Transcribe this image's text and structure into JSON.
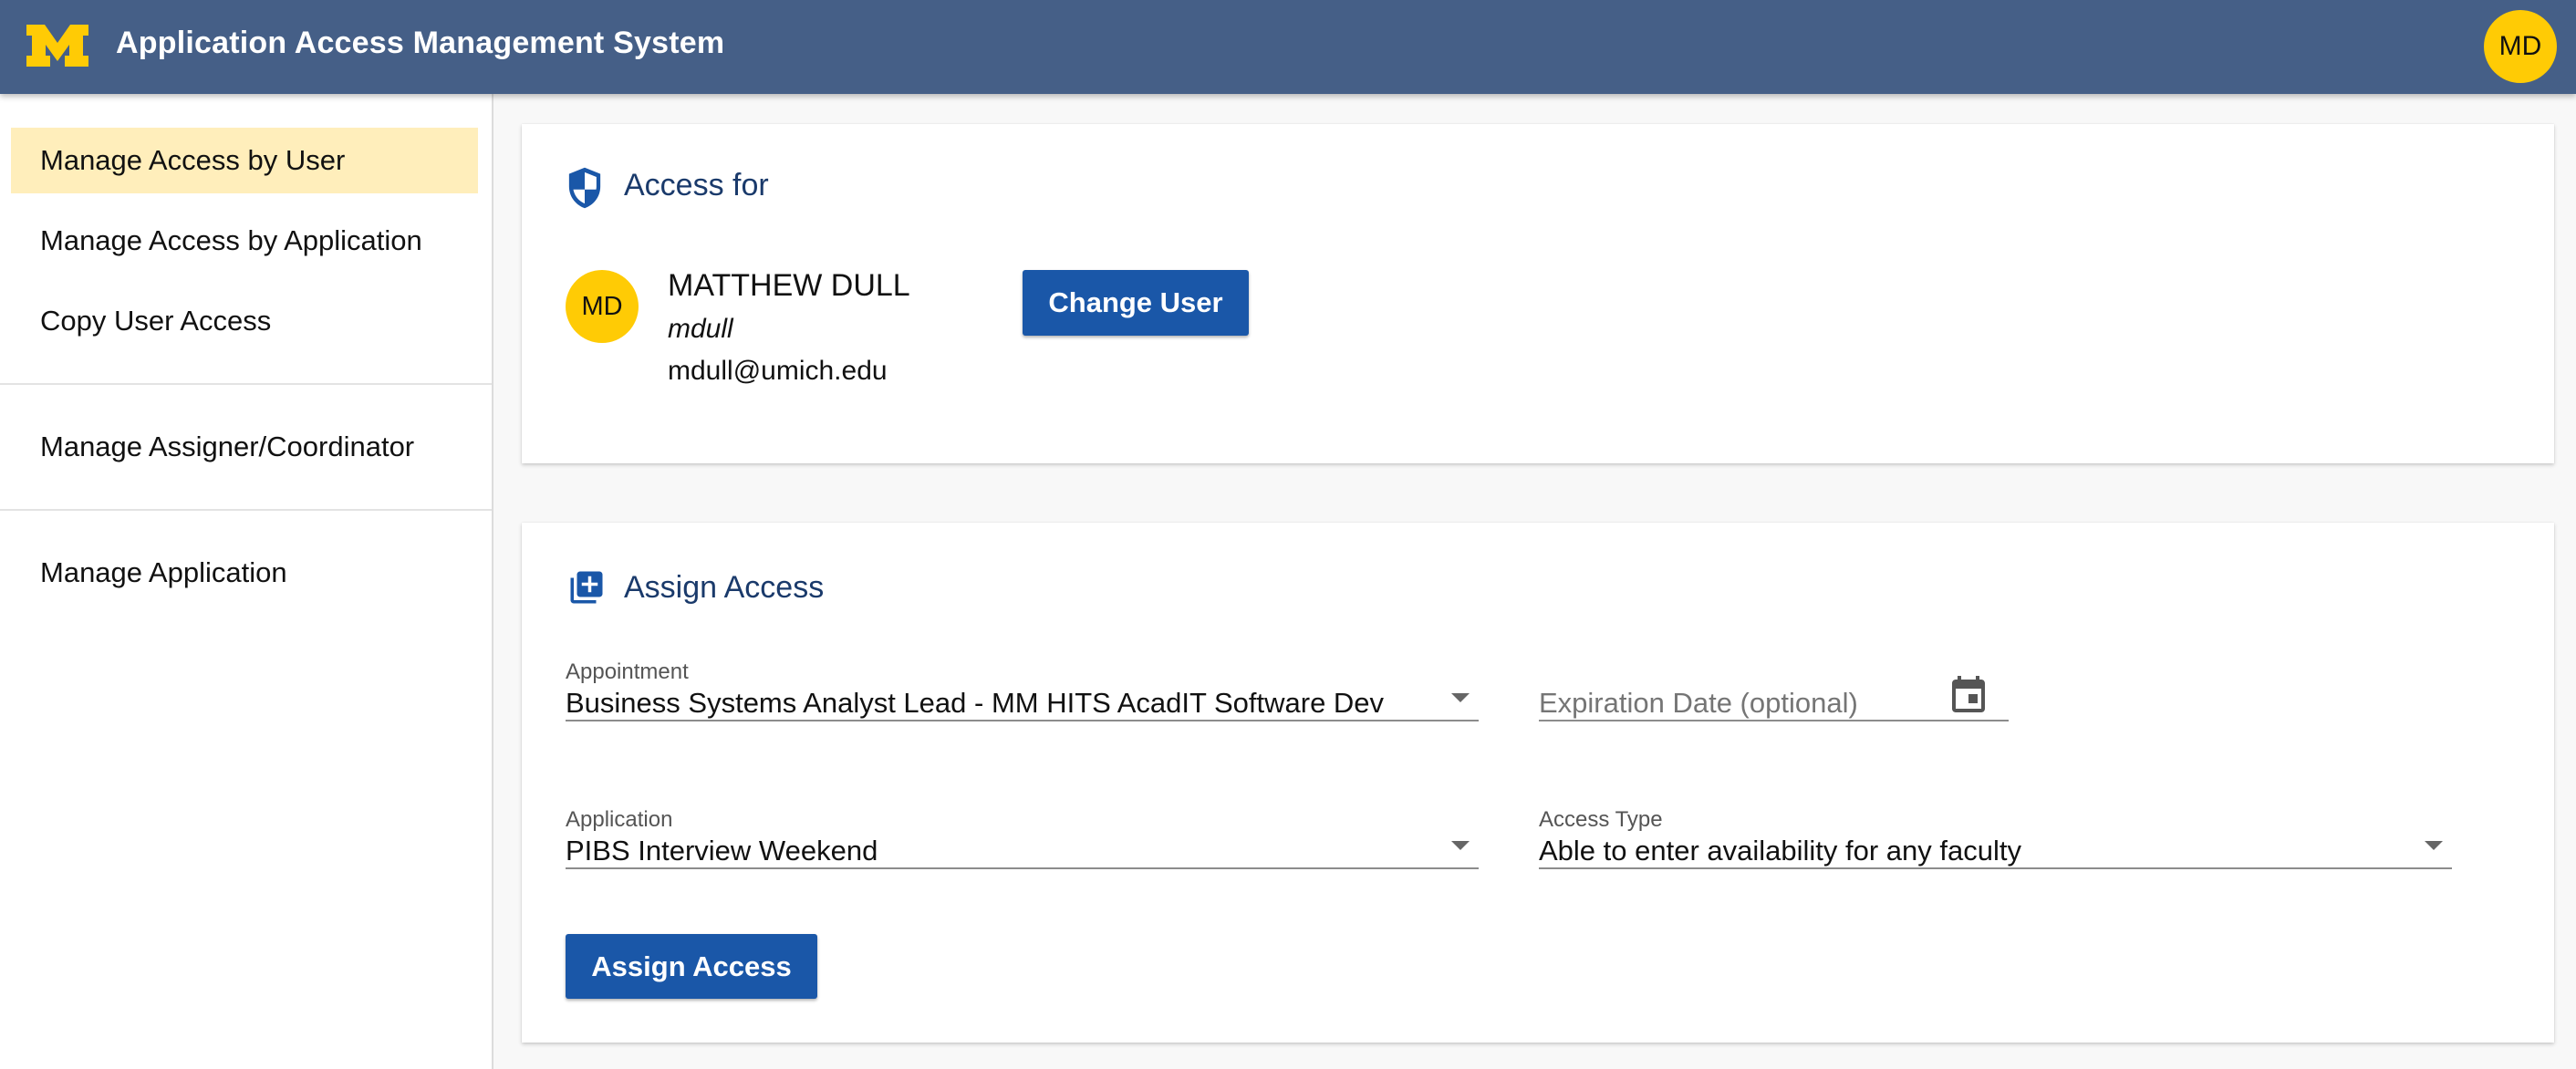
{
  "header": {
    "title": "Application Access Management System",
    "user_initials": "MD",
    "brand_color": "#455f87",
    "accent_color": "#ffcb05"
  },
  "sidebar": {
    "items": [
      {
        "label": "Manage Access by User",
        "active": true
      },
      {
        "label": "Manage Access by Application",
        "active": false
      },
      {
        "label": "Copy User Access",
        "active": false
      },
      {
        "label": "Manage Assigner/Coordinator",
        "active": false
      },
      {
        "label": "Manage Application",
        "active": false
      }
    ]
  },
  "access_card": {
    "title": "Access for",
    "icon": "shield-icon",
    "user": {
      "initials": "MD",
      "name": "MATTHEW DULL",
      "uniqname": "mdull",
      "email": "mdull@umich.edu"
    },
    "change_user_label": "Change User"
  },
  "assign_card": {
    "title": "Assign Access",
    "icon": "library-add-icon",
    "appointment": {
      "label": "Appointment",
      "value": "Business Systems Analyst Lead - MM HITS AcadIT Software Dev"
    },
    "expiration": {
      "placeholder": "Expiration Date (optional)",
      "icon": "calendar-icon"
    },
    "application": {
      "label": "Application",
      "value": "PIBS Interview Weekend"
    },
    "access_type": {
      "label": "Access Type",
      "value": "Able to enter availability for any faculty"
    },
    "assign_label": "Assign Access",
    "button_color": "#1a57a8"
  }
}
